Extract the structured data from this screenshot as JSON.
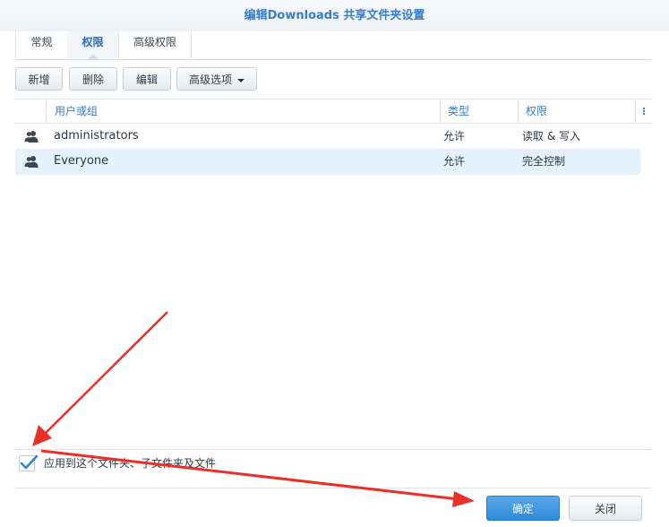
{
  "window": {
    "title": "编辑Downloads 共享文件夹设置"
  },
  "tabs": [
    {
      "label": "常规"
    },
    {
      "label": "权限"
    },
    {
      "label": "高级权限"
    }
  ],
  "toolbar": {
    "add_label": "新增",
    "delete_label": "删除",
    "edit_label": "编辑",
    "advanced_label": "高级选项"
  },
  "grid": {
    "columns": [
      "用户或组",
      "类型",
      "权限"
    ],
    "rows": [
      {
        "user": "administrators",
        "type": "允许",
        "permission": "读取 & 写入",
        "selected": false
      },
      {
        "user": "Everyone",
        "type": "允许",
        "permission": "完全控制",
        "selected": true
      }
    ]
  },
  "apply_option": {
    "label": "应用到这个文件夹、子文件夹及文件",
    "checked": true
  },
  "footer": {
    "ok_label": "确定",
    "close_label": "关闭"
  },
  "colors": {
    "accent": "#3a7dc8",
    "selected_row": "#e6f2fb",
    "primary_button": "#2f8ad8",
    "annotation_arrow": "#e8302a"
  },
  "icons": [
    "user-group-icon",
    "chevron-down-icon",
    "column-menu-icon",
    "checkmark-icon"
  ]
}
